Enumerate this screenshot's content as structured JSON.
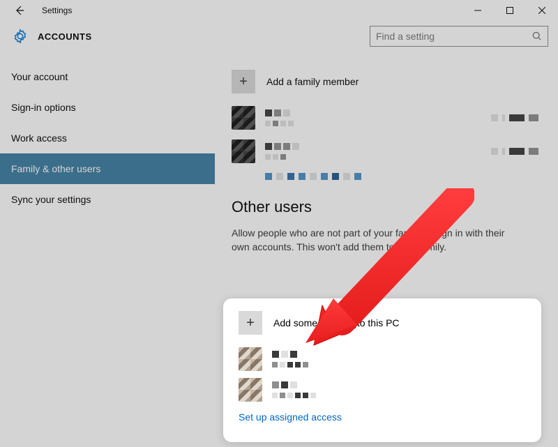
{
  "window": {
    "title": "Settings"
  },
  "header": {
    "category": "ACCOUNTS",
    "search_placeholder": "Find a setting"
  },
  "sidebar": {
    "items": [
      {
        "label": "Your account",
        "selected": false
      },
      {
        "label": "Sign-in options",
        "selected": false
      },
      {
        "label": "Work access",
        "selected": false
      },
      {
        "label": "Family & other users",
        "selected": true
      },
      {
        "label": "Sync your settings",
        "selected": false
      }
    ]
  },
  "main": {
    "add_family_label": "Add a family member",
    "other_users_heading": "Other users",
    "other_users_desc": "Allow people who are not part of your family to sign in with their own accounts. This won't add them to your family.",
    "add_other_label": "Add someone else to this PC",
    "assigned_access_link": "Set up assigned access"
  },
  "icons": {
    "plus": "+"
  }
}
